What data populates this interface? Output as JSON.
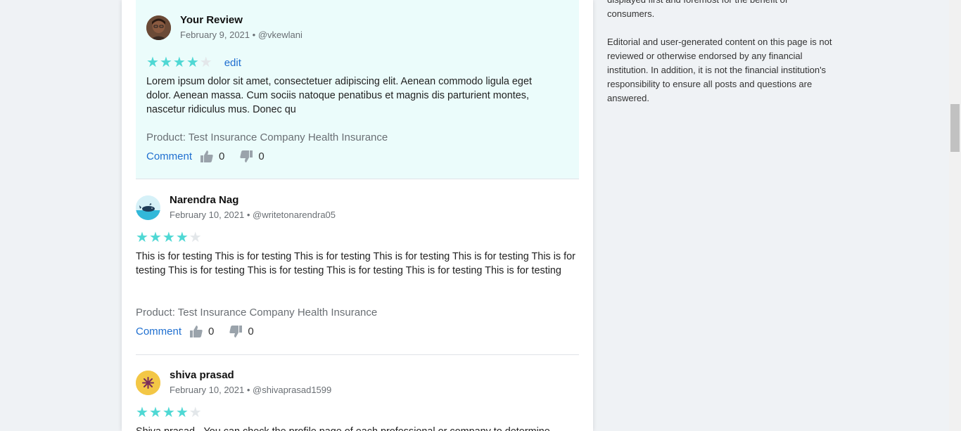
{
  "reviews": [
    {
      "name": "Your Review",
      "date": "February 9, 2021",
      "handle": "@vkewlani",
      "rating": 4,
      "edit_label": "edit",
      "text": "Lorem ipsum dolor sit amet, consectetuer adipiscing elit. Aenean commodo ligula eget dolor. Aenean massa. Cum sociis natoque penatibus et magnis dis parturient montes, nascetur ridiculus mus. Donec qu",
      "product": "Product: Test Insurance Company Health Insurance",
      "comment_label": "Comment",
      "likes": "0",
      "dislikes": "0"
    },
    {
      "name": "Narendra Nag",
      "date": "February 10, 2021",
      "handle": "@writetonarendra05",
      "rating": 4,
      "text": "This is for testing This is for testing This is for testing This is for testing This is for testing This is for testing This is for testing This is for testing This is for testing This is for testing This is for testing",
      "product": "Product: Test Insurance Company Health Insurance",
      "comment_label": "Comment",
      "likes": "0",
      "dislikes": "0"
    },
    {
      "name": "shiva prasad",
      "date": "February 10, 2021",
      "handle": "@shivaprasad1599",
      "rating": 4,
      "text": "Shiva prasad - You can check the profile page of each professional or company to determine"
    }
  ],
  "sidebar": {
    "top_text": "displayed first and foremost for the benefit of consumers.",
    "disclaimer": "Editorial and user-generated content on this page is not reviewed or otherwise endorsed by any financial institution. In addition, it is not the financial institution's responsibility to ensure all posts and questions are answered."
  },
  "colors": {
    "star_on": "#4fd8d4",
    "star_off": "#e3e7ea",
    "link": "#1f6fd0",
    "own_review_bg": "#ebfcfb"
  }
}
